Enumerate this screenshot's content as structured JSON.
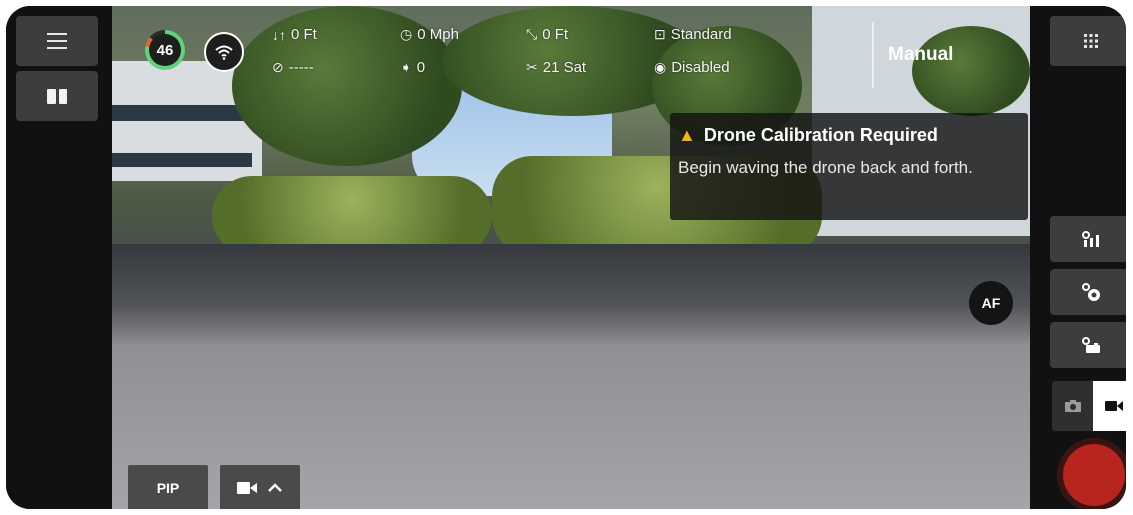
{
  "left_panel": {
    "menu_icon": "hamburger-menu-icon",
    "split_view_icon": "split-view-icon"
  },
  "status": {
    "battery_percent": "46",
    "battery_level": 0.78,
    "signal_icon": "wifi-signal-icon"
  },
  "telemetry": {
    "altitude": "0 Ft",
    "distance": "-----",
    "speed": "0 Mph",
    "obstacle": "0",
    "home_distance": "0 Ft",
    "satellites": "21 Sat",
    "flight_mode": "Standard",
    "visual_status": "Disabled"
  },
  "control_mode": "Manual",
  "alert": {
    "title": "Drone Calibration Required",
    "message": "Begin waving the drone back and forth.",
    "icon": "warning-icon",
    "icon_color": "#f3b21c"
  },
  "focus_button": "AF",
  "right_panel": {
    "grid_icon": "apps-grid-icon",
    "tool_icons": [
      "camera-settings-icon",
      "exposure-settings-icon",
      "photo-settings-icon"
    ],
    "camera_mode_selected": "video",
    "record_color": "#b8251f"
  },
  "bottom_bar": {
    "pip_label": "PIP",
    "camera_source_icon": "video-camera-icon",
    "expand_icon": "chevron-up-icon"
  }
}
